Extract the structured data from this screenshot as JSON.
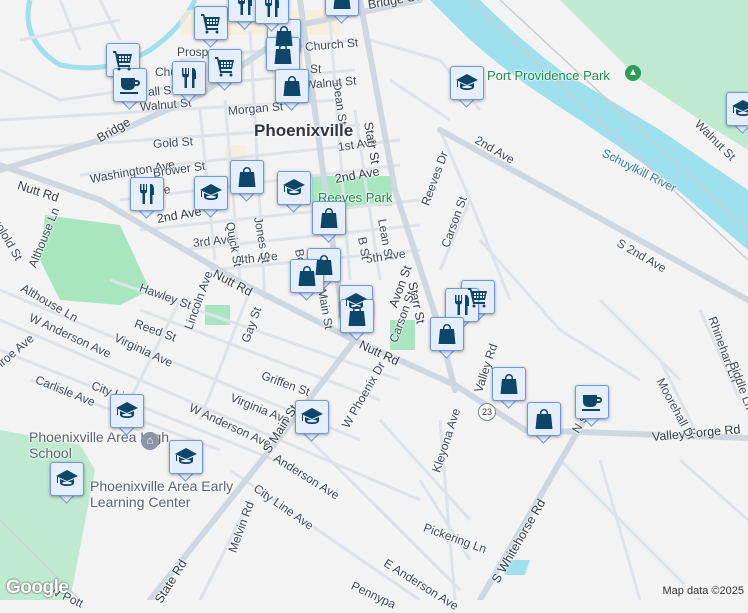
{
  "map": {
    "city": "Phoenixville",
    "route_shield": "23",
    "attribution": "Map data ©2025",
    "logo": "Google",
    "colors": {
      "water": "#9fe0ee",
      "park": "#a8e6bf",
      "road": "#d2dae2",
      "marker_fill": "#e5eefc",
      "marker_border": "#6f98e0",
      "icon": "#0d4668"
    }
  },
  "labels": {
    "bridge_st_ne": "Bridge St",
    "church_st": "Church St",
    "dean_st": "Dean St",
    "prospect": "Prosp",
    "chu": "Chu",
    "walnut_st_w": "Walnut St",
    "all_st": "all St",
    "walnut_st_e": "Walnut St",
    "church_st2": "St",
    "morgan_st": "Morgan St",
    "bridge_w": "Bridge",
    "gold_st": "Gold St",
    "washington_ave": "Washington Ave",
    "brower_st": "Brower St",
    "first_ave": "1st Ave",
    "second_ave_c": "2nd Ave",
    "second_ave_w": "2nd Ave",
    "ave_w": "Ave",
    "reeves_park": "Reeves Park",
    "starr_st_n": "Starr St",
    "starr_st_s": "Starr St",
    "nutt_rd_w": "Nutt Rd",
    "nutt_rd_c": "Nutt Rd",
    "nutt_rd_e": "Nutt Rd",
    "third_ave": "3rd Ave",
    "fourth_ave": "4th Ave",
    "fifth_ave": "5th Ave",
    "quick_st": "Quick St",
    "jones_st": "Jones St",
    "lean_st": "Lean St",
    "b_st": "B St",
    "bo": "Bo",
    "main_st": "Main St",
    "avon_st": "Avon St",
    "reeves_dr": "Reeves Dr",
    "carson_st_n": "Carson St",
    "carson_st_s": "Carson St",
    "second_ave_e": "2nd Ave",
    "s_second_ave": "S 2nd Ave",
    "port_providence": "Port Providence Park",
    "schuylkill": "Schuylkill River",
    "walnut_st_ne": "Walnut St",
    "marigold": "golold St",
    "althouse_n": "Althouse Ln",
    "althouse_s": "Althouse Ln",
    "hawley_st": "Hawley St",
    "lincoln_ave": "Lincoln Ave",
    "reed_st": "Reed St",
    "virginia_ave_w": "Virginia Ave",
    "w_anderson_w": "W Anderson Ave",
    "monroe_ave": "nroe Ave",
    "carlisle_ave": "Carlisle Ave",
    "city_line_w": "City Line",
    "gay_st": "Gay St",
    "griffen_st": "Griffen St",
    "virginia_ave_c": "Virginia Ave",
    "w_anderson_c": "W Anderson Ave",
    "s_main_st": "S Main St",
    "w_phoenix_dr": "W Phoenix Dr",
    "high_school": "Phoenixville Area High School",
    "early_learning": "Phoenixville Area Early Learning Center",
    "anderson_ave": "Anderson Ave",
    "city_line_ave": "City Line Ave",
    "melvin_rd": "Melvin Rd",
    "state_rd": "State Rd",
    "e_anderson_ave": "E Anderson Ave",
    "pennypacker": "Pennypa",
    "pickering_ln": "Pickering Ln",
    "kleyona_ave": "Kleyona Ave",
    "valley_rd": "Valley Rd",
    "s_whitehorse_rd": "S Whitehorse Rd",
    "valley_forge_rd": "Valley Forge Rd",
    "moorehall_dr": "Moorehall Dr",
    "whitehorse_n": "N     se Rd",
    "rhinehart_ln": "Rhinehart Ln",
    "biddle_ln": "Biddle Ln",
    "w_pott": "W Pott"
  },
  "markers": [
    {
      "icon": "cart"
    },
    {
      "icon": "coffee"
    },
    {
      "icon": "cart"
    },
    {
      "icon": "restaurant"
    },
    {
      "icon": "cart"
    },
    {
      "icon": "shopping"
    },
    {
      "icon": "shopping"
    },
    {
      "icon": "shopping"
    },
    {
      "icon": "restaurant"
    },
    {
      "icon": "school"
    },
    {
      "icon": "shopping"
    },
    {
      "icon": "school"
    },
    {
      "icon": "shopping"
    },
    {
      "icon": "shopping"
    },
    {
      "icon": "shopping"
    },
    {
      "icon": "school"
    },
    {
      "icon": "shopping"
    },
    {
      "icon": "school"
    },
    {
      "icon": "cart"
    },
    {
      "icon": "restaurant"
    },
    {
      "icon": "shopping"
    },
    {
      "icon": "shopping"
    },
    {
      "icon": "shopping"
    },
    {
      "icon": "coffee"
    },
    {
      "icon": "school"
    },
    {
      "icon": "school"
    },
    {
      "icon": "school"
    },
    {
      "icon": "school"
    },
    {
      "icon": "school"
    },
    {
      "icon": "restaurant"
    },
    {
      "icon": "restaurant"
    },
    {
      "icon": "shopping"
    }
  ]
}
